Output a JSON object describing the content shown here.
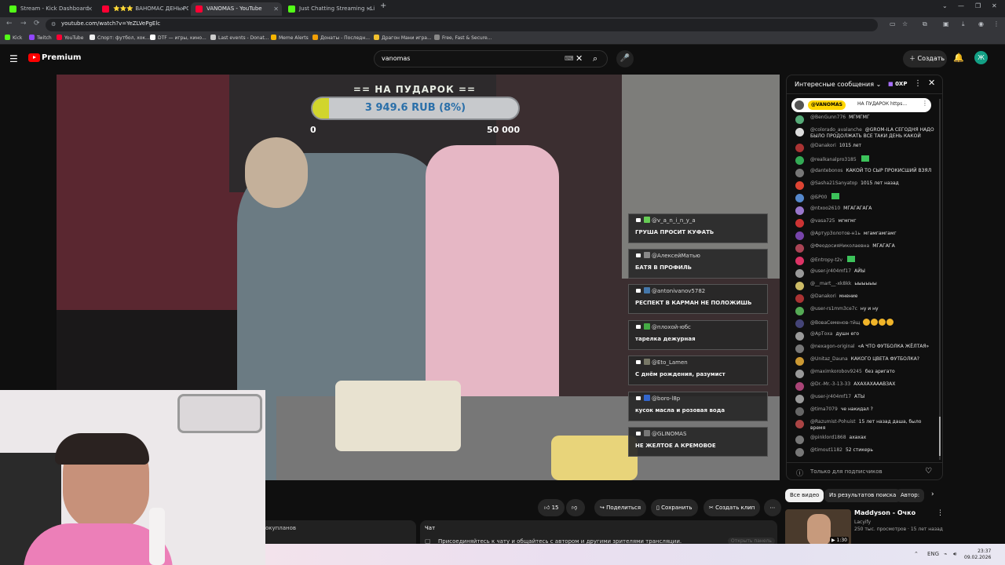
{
  "browser": {
    "tabs": [
      {
        "title": "Stream - Kick Dashboard",
        "color": "#53fc18"
      },
      {
        "title": "⭐⭐⭐ ВАНОМАС ДЕНЬ РОЖ",
        "color": "#ff0033"
      },
      {
        "title": "VANOMAS - YouTube",
        "color": "#ff0033"
      },
      {
        "title": "Just Chatting Streaming - Live",
        "color": "#53fc18"
      }
    ],
    "url": "youtube.com/watch?v=YeZLVePgElc",
    "bookmarks": [
      {
        "label": "Kick",
        "color": "#53fc18"
      },
      {
        "label": "Twitch",
        "color": "#9146ff"
      },
      {
        "label": "YouTube",
        "color": "#ff0033"
      },
      {
        "label": "Спорт: футбол, хок...",
        "color": "#eeeeee"
      },
      {
        "label": "DTF — игры, кино...",
        "color": "#ffffff"
      },
      {
        "label": "Last events - Donat...",
        "color": "#cccccc"
      },
      {
        "label": "Meme Alerts",
        "color": "#f7b500"
      },
      {
        "label": "Донаты - Последн...",
        "color": "#f29f05"
      },
      {
        "label": "Драгон Мани игра...",
        "color": "#f2c12e"
      },
      {
        "label": "Free, Fast & Secure...",
        "color": "#888888"
      }
    ]
  },
  "header": {
    "brand": "Premium",
    "search_value": "vanomas",
    "create_label": "Создать",
    "avatar_letter": "Ж"
  },
  "donation": {
    "title": "== НА ПУДАРОК ==",
    "amount_label": "3 949.6 RUB (8%)",
    "progress": 0.08,
    "min": "0",
    "max": "50 000"
  },
  "overlay_chat": [
    {
      "user": "@v_a_n_i_n_y_a",
      "text": "ГРУША ПРОСИТ КУФАТЬ",
      "av": "#6c5"
    },
    {
      "user": "@АлексейМатью",
      "text": "БАТЯ В ПРОФИЛЬ",
      "av": "#888"
    },
    {
      "user": "@antonivanov5782",
      "text": "РЕСПЕКТ В КАРМАН НЕ ПОЛОЖИШЬ",
      "av": "#47a"
    },
    {
      "user": "@плохой-юбс",
      "text": "тарелка дежурная",
      "av": "#4a4"
    },
    {
      "user": "@Eto_Lamen",
      "text": "С днём рождения, разумист",
      "av": "#776"
    },
    {
      "user": "@boro-l8p",
      "text": "кусок масла и розовая вода",
      "av": "#36c"
    },
    {
      "user": "@GLINOMAS",
      "text": "НЕ ЖЕЛТОЕ А КРЕМОВОЕ",
      "av": "#777"
    }
  ],
  "chat": {
    "mode": "Интересные сообщения",
    "xp": "0XP",
    "pinned_user": "@VANOMAS",
    "pinned_text": "НА ПУДАРОК https...",
    "messages": [
      {
        "user": "@BenGunn776",
        "text": "МГМГМГ",
        "av": "#5a7"
      },
      {
        "user": "@colorado_avalanche",
        "text": "@GROM-ILA СЕГОДНЯ НАДО БЫЛО ПРОДОЛЖАТЬ ВСЕ ТАКИ ДЕНЬ КАКОЙ",
        "av": "#ddd"
      },
      {
        "user": "@Danakori",
        "text": "1015 лет",
        "av": "#a33"
      },
      {
        "user": "@realkanalpro3185",
        "text": "",
        "av": "#3a5",
        "emote": true
      },
      {
        "user": "@dantebonos",
        "text": "КАКОЙ ТО СЫР ПРОКИСШИЙ ВЗЯЛ",
        "av": "#777"
      },
      {
        "user": "@Sasha21Sanyatop",
        "text": "1015 лет назад",
        "av": "#d43"
      },
      {
        "user": "@БР00",
        "text": "",
        "av": "#58c",
        "emote": true
      },
      {
        "user": "@ntxoo2610",
        "text": "МГАГАГАГА",
        "av": "#97c"
      },
      {
        "user": "@vasa725",
        "text": "мгмгмг",
        "av": "#c33"
      },
      {
        "user": "@Артур3олотов-н1ь",
        "text": "мгамгамгамг",
        "av": "#74a"
      },
      {
        "user": "@ФеодосияНиколаевна",
        "text": "МГАГАГА",
        "av": "#a45"
      },
      {
        "user": "@Entropy-t2v",
        "text": "",
        "av": "#d36",
        "emote": true
      },
      {
        "user": "@user-jr404mf17",
        "text": "АЙЫ",
        "av": "#999"
      },
      {
        "user": "@__mart__-xk8kk",
        "text": "ыыыыыы",
        "av": "#cb6"
      },
      {
        "user": "@Danakori",
        "text": "мнение",
        "av": "#a33"
      },
      {
        "user": "@user-rs1mm3ce7c",
        "text": "ну и ну",
        "av": "#5a5"
      },
      {
        "user": "@ВоваСеменов-тйщ",
        "text": "",
        "av": "#447",
        "smileys": 4
      },
      {
        "user": "@АрТоха",
        "text": "душн его",
        "av": "#999"
      },
      {
        "user": "@nexagon-original",
        "text": "«А ЧТО ФУТБОЛКА ЖЁЛТАЯ»",
        "av": "#777"
      },
      {
        "user": "@Unitaz_Dauna",
        "text": "КАКОГО ЦВЕТА ФУТБОЛКА?",
        "av": "#c93"
      },
      {
        "user": "@maximkorobov9245",
        "text": "без аригато",
        "av": "#999"
      },
      {
        "user": "@Dr.-Mr.-3-13-33",
        "text": "АХАХАХАААВЗАХ",
        "av": "#a47"
      },
      {
        "user": "@user-jr404mf17",
        "text": "АТЫ",
        "av": "#999"
      },
      {
        "user": "@tima7079",
        "text": "че накидал ?",
        "av": "#666"
      },
      {
        "user": "@Razumist-Pohuist",
        "text": "15 лет назад даша, было время",
        "av": "#a44"
      },
      {
        "user": "@pinklord1868",
        "text": "ахахах",
        "av": "#777"
      },
      {
        "user": "@timout1182",
        "text": "52 стикерь",
        "av": "#777"
      }
    ],
    "footer": "Только для подписчиков"
  },
  "actions": {
    "likes": "15",
    "share": "Поделиться",
    "save": "Сохранить",
    "clip": "Создать клип"
  },
  "recs": {
    "tabs": [
      "Все видео",
      "Из результатов поиска",
      "Автор:"
    ],
    "video": {
      "title": "Maddyson - Очко",
      "channel": "Lacyify",
      "meta": "250 тыс. просмотров · 15 лет назад",
      "duration": "1:30"
    }
  },
  "below": {
    "desc_snippet": "окупланов",
    "chat_replay_title": "Чат",
    "chat_replay_text": "Присоединяйтесь к чату и общайтесь с автором и другими зрителями трансляции.",
    "chat_replay_btn": "Открыть панель"
  },
  "taskbar": {
    "lang": "ENG",
    "time": "23:37",
    "date": "09.02.2026"
  }
}
